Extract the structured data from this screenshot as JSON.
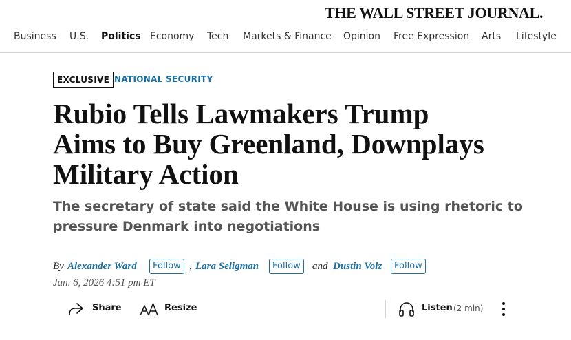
{
  "masthead": {
    "logo_text": "THE WALL STREET JOURNAL."
  },
  "nav": {
    "items": [
      "Business",
      "U.S.",
      "Politics",
      "Economy",
      "Tech",
      "Markets & Finance",
      "Opinion",
      "Free Expression",
      "Arts",
      "Lifestyle"
    ],
    "active": "Politics"
  },
  "article": {
    "flag": "EXCLUSIVE",
    "section": "NATIONAL SECURITY",
    "headline_lines": [
      "Rubio Tells Lawmakers Trump",
      "Aims to Buy Greenland, Downplays",
      "Military Action"
    ],
    "dek_lines": [
      "The secretary of state said the White House is using rhetoric to",
      "pressure Denmark into negotiations"
    ],
    "byline": {
      "prefix": "By",
      "separator": ",",
      "conjunction": "and",
      "follow_label": "Follow",
      "authors": [
        "Alexander Ward",
        "Lara Seligman",
        "Dustin Volz"
      ]
    },
    "timestamp": "Jan. 6, 2026 4:51 pm ET"
  },
  "toolbar": {
    "share_label": "Share",
    "resize_label": "Resize",
    "listen_label": "Listen",
    "listen_duration": "(2 min)",
    "icons": [
      "share-icon",
      "resize-icon",
      "headphones-icon",
      "more-icon"
    ]
  },
  "colors": {
    "accent": "#1a6ea0",
    "text": "#111111",
    "muted": "#555555",
    "rule": "#d4d4d4"
  }
}
